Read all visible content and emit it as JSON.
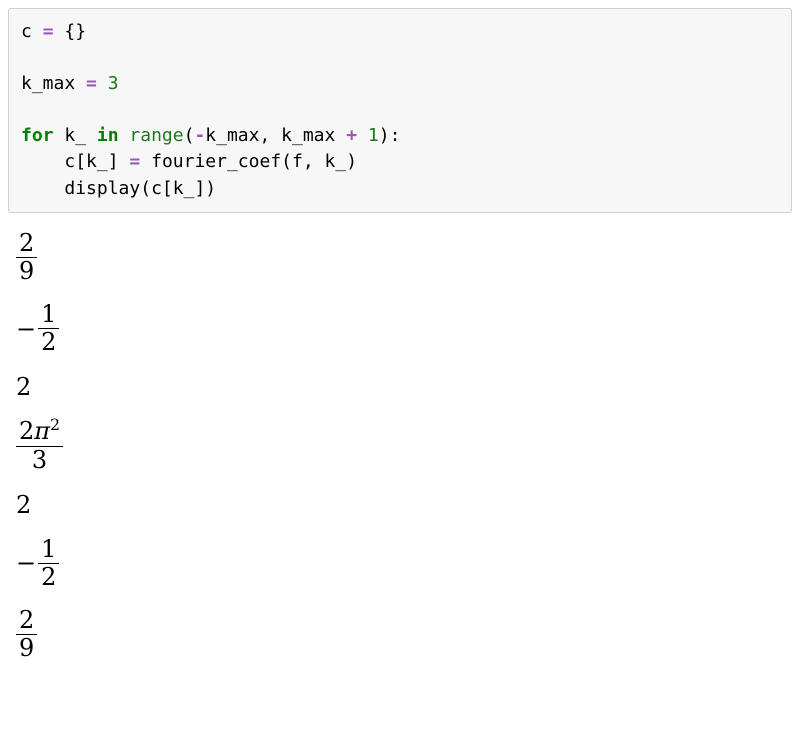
{
  "code": {
    "line1": {
      "var": "c",
      "op_eq": "=",
      "braces": "{}"
    },
    "blank_a": "",
    "line2": {
      "var": "k_max",
      "op_eq": "=",
      "val": "3"
    },
    "blank_b": "",
    "line3": {
      "kw_for": "for",
      "iter": "k_",
      "kw_in": "in",
      "fn_range": "range",
      "lparen": "(",
      "op_neg": "-",
      "arg1": "k_max",
      "comma": ", ",
      "arg2": "k_max",
      "op_plus": "+",
      "one": "1",
      "rparen_colon": "):"
    },
    "line4": {
      "indent": "    ",
      "lhs_a": "c",
      "lbr": "[",
      "idx": "k_",
      "rbr": "]",
      "op_eq": "=",
      "rhs_fn": "fourier_coef",
      "lparen": "(",
      "arg_a": "f",
      "comma": ", ",
      "arg_b": "k_",
      "rparen": ")"
    },
    "line5": {
      "indent": "    ",
      "fn": "display",
      "lparen": "(",
      "arg_a": "c",
      "lbr": "[",
      "idx": "k_",
      "rbr": "]",
      "rparen": ")"
    }
  },
  "outputs": {
    "o1": {
      "type": "frac",
      "sign": "",
      "num": "2",
      "den": "9"
    },
    "o2": {
      "type": "frac",
      "sign": "−",
      "num": "1",
      "den": "2"
    },
    "o3": {
      "type": "plain",
      "text": "2"
    },
    "o4": {
      "type": "frac_sup",
      "sign": "",
      "num_a": "2",
      "num_pi": "π",
      "num_exp": "2",
      "den": "3"
    },
    "o5": {
      "type": "plain",
      "text": "2"
    },
    "o6": {
      "type": "frac",
      "sign": "−",
      "num": "1",
      "den": "2"
    },
    "o7": {
      "type": "frac",
      "sign": "",
      "num": "2",
      "den": "9"
    }
  }
}
